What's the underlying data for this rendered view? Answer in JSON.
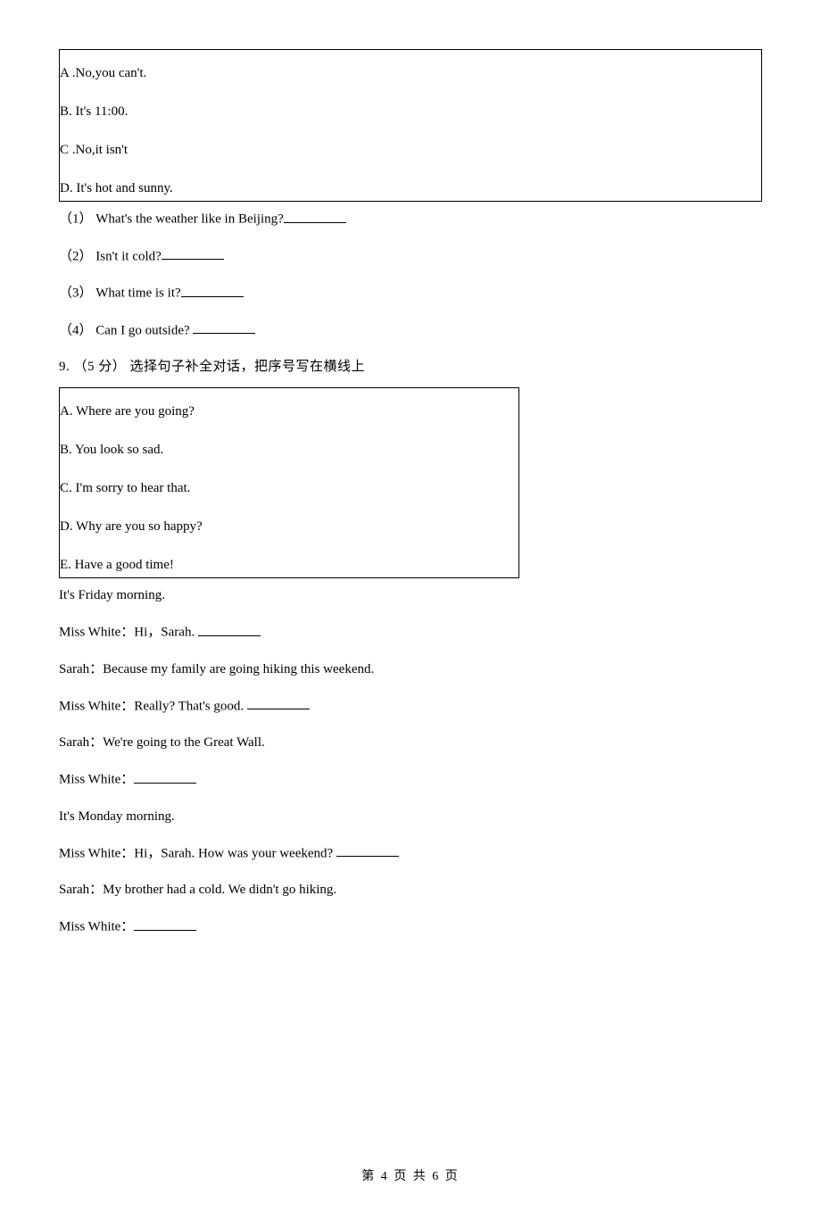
{
  "box_top": {
    "a": "A .No,you can't.",
    "b": "B. It's 11:00.",
    "c": "C .No,it isn't",
    "d": "D. It's hot and sunny."
  },
  "q8": {
    "line1": "（1） What's the weather like in Beijing?",
    "line2": "（2） Isn't it cold?",
    "line3": "（3） What time is it?",
    "line4": "（4） Can I go outside? "
  },
  "q9": {
    "prompt": "9. （5 分）  选择句子补全对话，把序号写在横线上",
    "box": {
      "a": "A. Where are you going?",
      "b": "B. You look so sad.",
      "c": "C. I'm sorry to hear that.",
      "d": "D. Why are you so happy?",
      "e": "E. Have a good time!"
    },
    "dialog": {
      "d1": "It's Friday morning.",
      "d2a": "Miss White：Hi，Sarah. ",
      "d3": "Sarah：Because my family are going hiking this weekend.",
      "d4a": "Miss White：Really? That's good. ",
      "d5": "Sarah：We're going to the Great Wall.",
      "d6a": "Miss White：",
      "d7": "It's Monday morning.",
      "d8a": "Miss White：Hi，Sarah. How was your weekend? ",
      "d9": "Sarah：My brother had a cold. We didn't go hiking.",
      "d10a": "Miss White："
    }
  },
  "footer": "第 4 页 共 6 页"
}
